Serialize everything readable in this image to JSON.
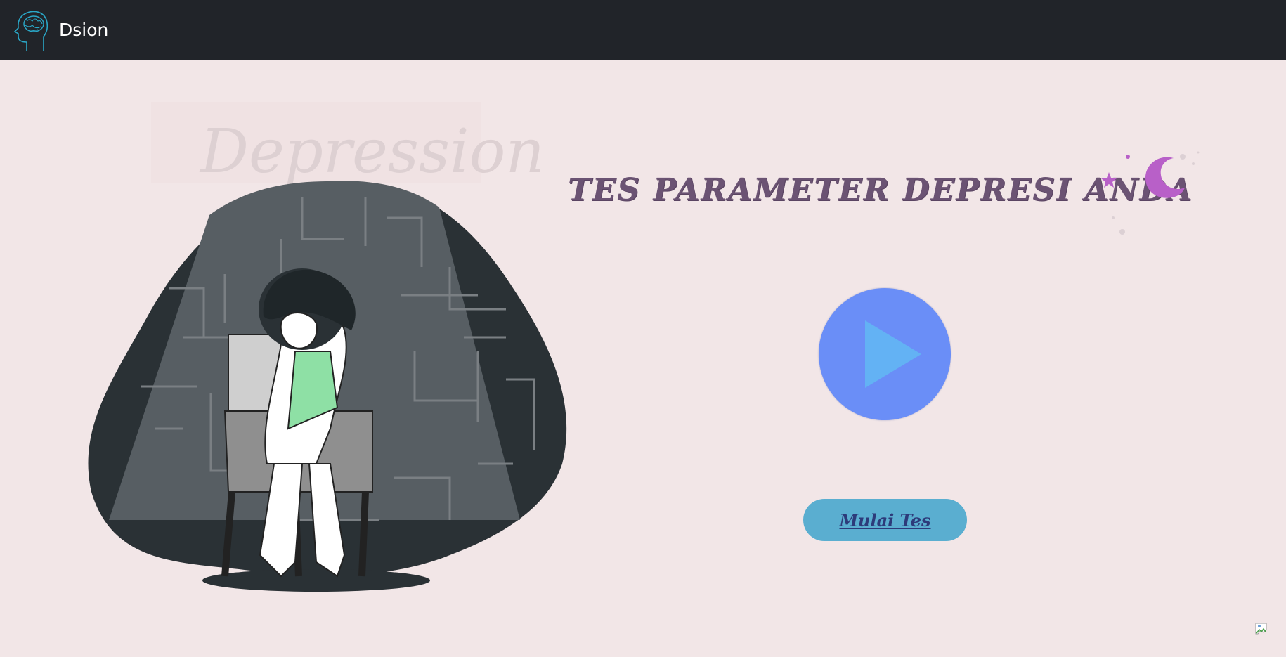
{
  "navbar": {
    "brand_name": "Dsion",
    "logo_icon": "brain-head-icon",
    "background": "#212429"
  },
  "hero": {
    "illustration_caption": "Depression",
    "title": "TES PARAMETER DEPRESI ANDA",
    "title_color": "#6b5373",
    "play_icon": "play-icon",
    "start_button_label": "Mulai Tes",
    "accent_play": "#6a8ef7",
    "accent_start": "#5aaed0"
  },
  "page": {
    "background": "#f2e6e7",
    "broken_image_icon": "broken-image-icon"
  }
}
